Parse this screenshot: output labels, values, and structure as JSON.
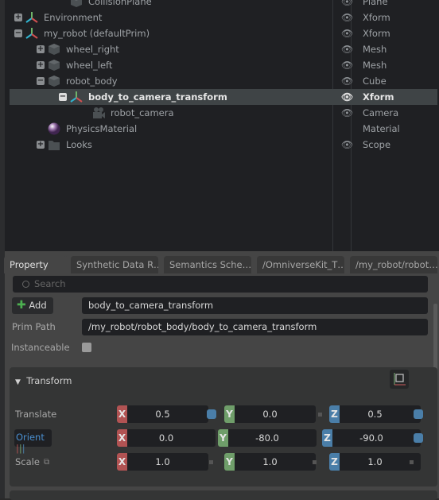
{
  "stage": {
    "rows": [
      {
        "name": "CollisionPlane",
        "type": "Plane",
        "icon": "cube-icon",
        "indent": 2,
        "expander": "",
        "eye": true
      },
      {
        "name": "Environment",
        "type": "Xform",
        "icon": "xform-icon",
        "indent": 0,
        "expander": "+",
        "eye": true
      },
      {
        "name": "my_robot (defaultPrim)",
        "type": "Xform",
        "icon": "xform-icon",
        "indent": 0,
        "expander": "-",
        "eye": true
      },
      {
        "name": "wheel_right",
        "type": "Mesh",
        "icon": "cube-icon",
        "indent": 1,
        "expander": "+",
        "eye": true
      },
      {
        "name": "wheel_left",
        "type": "Mesh",
        "icon": "cube-icon",
        "indent": 1,
        "expander": "+",
        "eye": true
      },
      {
        "name": "robot_body",
        "type": "Cube",
        "icon": "cube-icon",
        "indent": 1,
        "expander": "-",
        "eye": true
      },
      {
        "name": "body_to_camera_transform",
        "type": "Xform",
        "icon": "xform-icon",
        "indent": 2,
        "expander": "-",
        "eye": true,
        "selected": true
      },
      {
        "name": "robot_camera",
        "type": "Camera",
        "icon": "camera-icon",
        "indent": 3,
        "expander": "",
        "eye": true
      },
      {
        "name": "PhysicsMaterial",
        "type": "Material",
        "icon": "material-sphere-icon",
        "indent": 1,
        "expander": "",
        "eye": false
      },
      {
        "name": "Looks",
        "type": "Scope",
        "icon": "folder-icon",
        "indent": 1,
        "expander": "+",
        "eye": true
      }
    ]
  },
  "tabs": [
    "Property",
    "Synthetic Data R…",
    "Semantics Sche…",
    "/OmniverseKit_T…",
    "/my_robot/robot…"
  ],
  "property": {
    "search_placeholder": "Search",
    "add_label": "Add",
    "prim_name": "body_to_camera_transform",
    "prim_path_label": "Prim Path",
    "prim_path": "/my_robot/robot_body/body_to_camera_transform",
    "instanceable_label": "Instanceable",
    "instanceable": false
  },
  "transform": {
    "title": "Transform",
    "rows": [
      {
        "label": "Translate",
        "x": "0.5",
        "y": "0.0",
        "z": "0.5"
      },
      {
        "label": "Orient",
        "x": "0.0",
        "y": "-80.0",
        "z": "-90.0"
      },
      {
        "label": "Scale",
        "x": "1.0",
        "y": "1.0",
        "z": "1.0"
      }
    ]
  },
  "colors": {
    "x": "#b15353",
    "y": "#6f9e6a",
    "z": "#4a7ea8",
    "selection": "#3f4446"
  }
}
